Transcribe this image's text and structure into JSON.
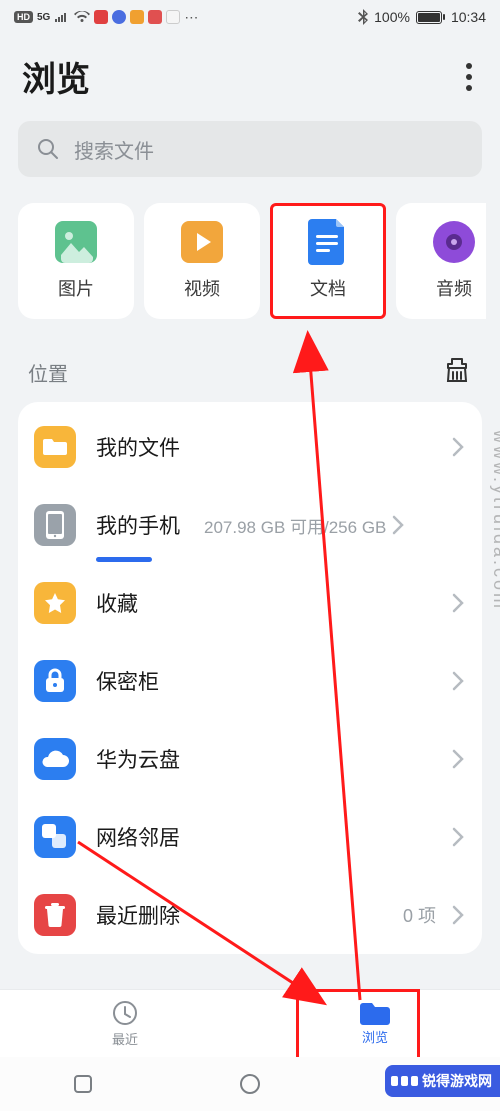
{
  "status": {
    "hd": "HD",
    "net": "5G",
    "battery": "100%",
    "time": "10:34"
  },
  "header": {
    "title": "浏览"
  },
  "search": {
    "placeholder": "搜索文件"
  },
  "categories": {
    "images": "图片",
    "videos": "视频",
    "docs": "文档",
    "audio": "音频"
  },
  "location": {
    "title": "位置"
  },
  "storage": {
    "my_files": "我的文件",
    "my_phone": "我的手机",
    "phone_free": "207.98 GB 可用/256 GB",
    "favorites": "收藏",
    "vault": "保密柜",
    "cloud": "华为云盘",
    "network": "网络邻居",
    "trash": "最近删除",
    "trash_count": "0 项"
  },
  "bottomnav": {
    "recent": "最近",
    "browse": "浏览"
  },
  "watermark": "www.ytruida.com",
  "logo": "锐得游戏网"
}
